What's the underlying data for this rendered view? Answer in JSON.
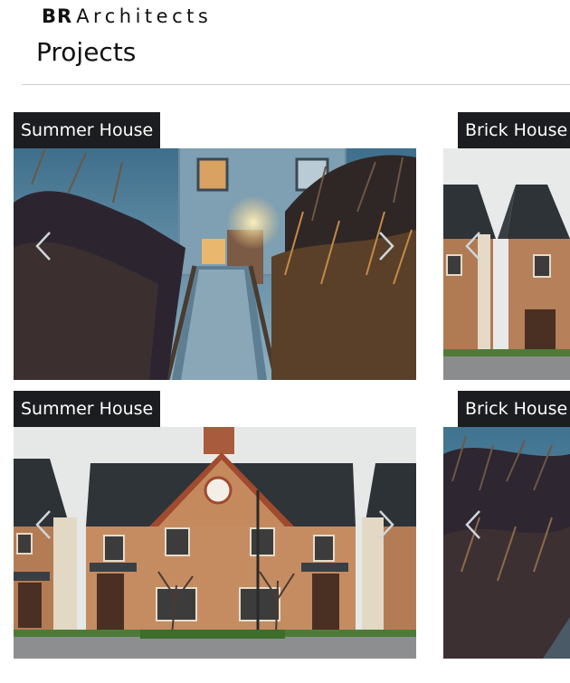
{
  "header": {
    "brand_bold": "BR",
    "brand_rest": "Architects",
    "page_title": "Projects"
  },
  "projects": [
    {
      "label": "Summer House",
      "photo_icon": "summer-house-photo"
    },
    {
      "label": "Brick House",
      "photo_icon": "brick-house-photo"
    },
    {
      "label": "Summer House",
      "photo_icon": "brick-house-photo"
    },
    {
      "label": "Brick House",
      "photo_icon": "summer-house-photo"
    }
  ],
  "colors": {
    "label_bg": "#1b1d20",
    "label_text": "#ffffff",
    "divider": "#cfcfcf"
  }
}
